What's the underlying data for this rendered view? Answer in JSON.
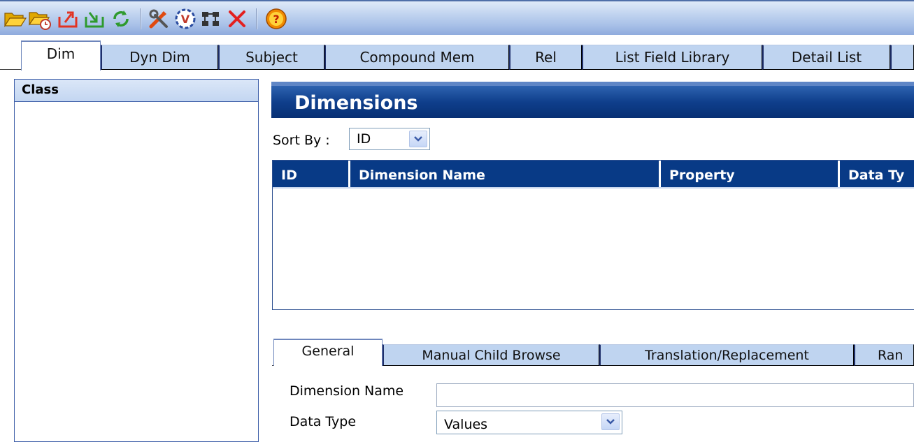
{
  "toolbar": {
    "icons": [
      "open-folder-icon",
      "open-recent-icon",
      "export-icon",
      "import-icon",
      "refresh-icon",
      "tools-icon",
      "validate-icon",
      "hierarchy-icon",
      "delete-icon",
      "help-icon"
    ],
    "colors": {
      "background": "#bcd0ee",
      "open": "#f2c012",
      "export": "#e23322",
      "import": "#33a033",
      "delete": "#e32020",
      "help": "#f08a00"
    }
  },
  "tabs": [
    {
      "label": "Dim",
      "active": true
    },
    {
      "label": "Dyn Dim"
    },
    {
      "label": "Subject"
    },
    {
      "label": "Compound Mem"
    },
    {
      "label": "Rel"
    },
    {
      "label": "List Field Library"
    },
    {
      "label": "Detail List"
    }
  ],
  "class_panel": {
    "title": "Class"
  },
  "dimensions": {
    "title": "Dimensions",
    "sort_label": "Sort By :",
    "sort_value": "ID",
    "columns": [
      "ID",
      "Dimension Name",
      "Property",
      "Data Ty"
    ],
    "rows": []
  },
  "subtabs": [
    {
      "label": "General",
      "active": true
    },
    {
      "label": "Manual Child Browse"
    },
    {
      "label": "Translation/Replacement"
    },
    {
      "label": "Ran"
    }
  ],
  "form": {
    "dimension_name_label": "Dimension Name",
    "dimension_name_value": "",
    "data_type_label": "Data Type",
    "data_type_value": "Values"
  },
  "colors": {
    "accent": "#083a86",
    "tab_inactive": "#bfd4f0",
    "panel_border": "#3d5ea8"
  }
}
